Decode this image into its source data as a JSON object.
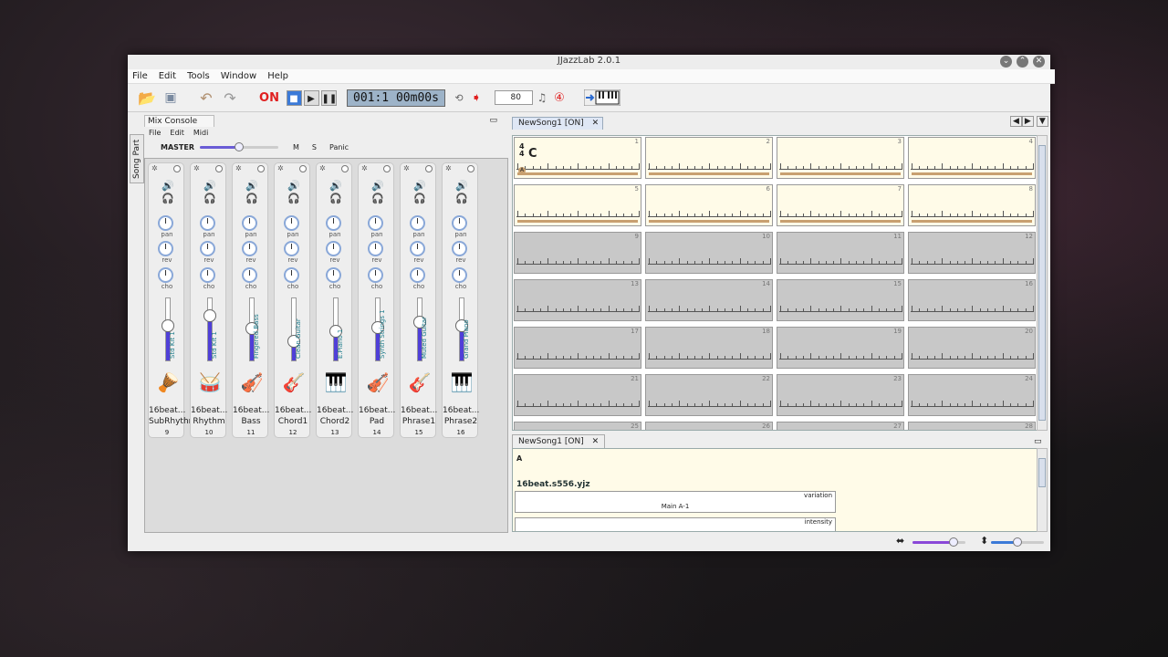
{
  "window": {
    "title": "JJazzLab  2.0.1"
  },
  "menu": [
    "File",
    "Edit",
    "Tools",
    "Window",
    "Help"
  ],
  "toolbar": {
    "on_label": "ON",
    "position": "001:1  00m00s",
    "tempo": "80"
  },
  "mix_console": {
    "side_tab": "Song Part",
    "tab_title": "Mix Console",
    "menu": [
      "File",
      "Edit",
      "Midi"
    ],
    "master_label": "MASTER",
    "master_level": 0.5,
    "m_label": "M",
    "s_label": "S",
    "panic_label": "Panic",
    "knob_labels": {
      "pan": "pan",
      "rev": "rev",
      "cho": "cho"
    },
    "channels": [
      {
        "instrument": "Std Kit 1",
        "style": "16beat...",
        "name": "SubRhythm",
        "channel": "9",
        "icon": "conga-icon",
        "level": 0.55
      },
      {
        "instrument": "Std Kit 1",
        "style": "16beat...",
        "name": "Rhythm",
        "channel": "10",
        "icon": "drumkit-icon",
        "level": 0.7
      },
      {
        "instrument": "Fingered Bass",
        "style": "16beat...",
        "name": "Bass",
        "channel": "11",
        "icon": "double-bass-icon",
        "level": 0.5
      },
      {
        "instrument": "Clean Guitar",
        "style": "16beat...",
        "name": "Chord1",
        "channel": "12",
        "icon": "guitar-icon",
        "level": 0.3
      },
      {
        "instrument": "E.Piano 1",
        "style": "16beat...",
        "name": "Chord2",
        "channel": "13",
        "icon": "keyboard-icon",
        "level": 0.45
      },
      {
        "instrument": "Synth Strings 1",
        "style": "16beat...",
        "name": "Pad",
        "channel": "14",
        "icon": "strings-icon",
        "level": 0.52
      },
      {
        "instrument": "Muted Guitar",
        "style": "16beat...",
        "name": "Phrase1",
        "channel": "15",
        "icon": "guitar-icon",
        "level": 0.6
      },
      {
        "instrument": "Grand Piano",
        "style": "16beat...",
        "name": "Phrase2",
        "channel": "16",
        "icon": "keyboard-icon",
        "level": 0.55
      }
    ]
  },
  "song": {
    "tab_title": "NewSong1 [ON]",
    "time_sig_top": "4",
    "time_sig_bottom": "4",
    "first_chord": "C",
    "section_marker": "A",
    "bar_numbers": [
      "1",
      "2",
      "3",
      "4",
      "5",
      "6",
      "7",
      "8",
      "9",
      "10",
      "11",
      "12",
      "13",
      "14",
      "15",
      "16",
      "17",
      "18",
      "19",
      "20",
      "21",
      "22",
      "23",
      "24",
      "25",
      "26",
      "27",
      "28"
    ],
    "active_bars": 8
  },
  "song_part": {
    "tab_title": "NewSong1 [ON]",
    "section": "A",
    "rhythm": "16beat.s556.yjz",
    "variation_label": "variation",
    "variation_value": "Main A-1",
    "intensity_label": "intensity"
  }
}
